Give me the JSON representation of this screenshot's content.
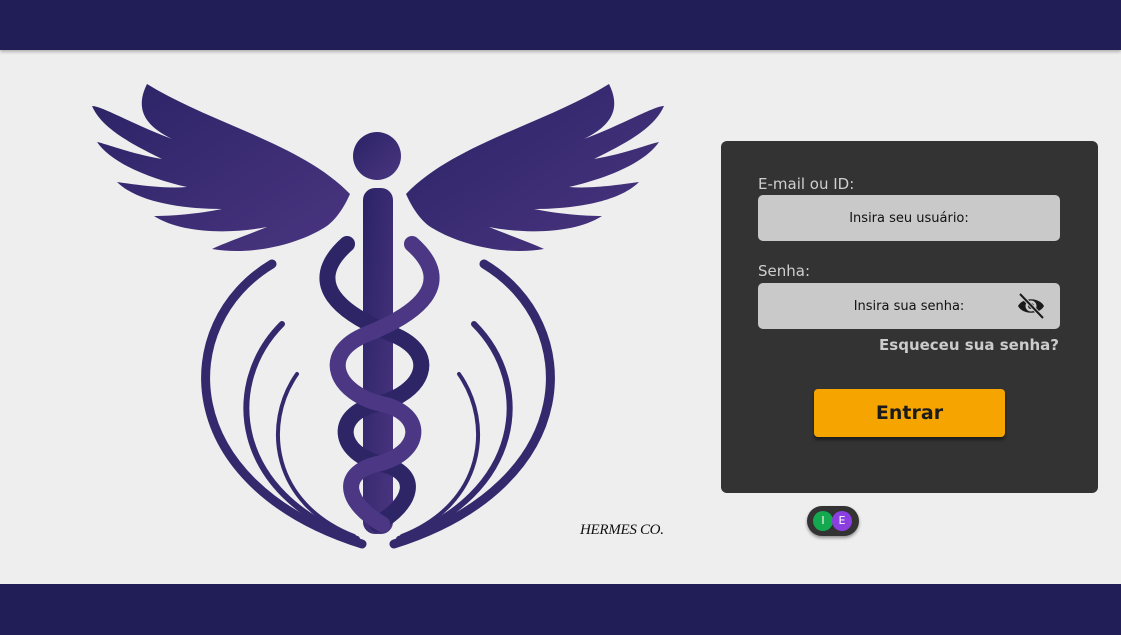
{
  "brand": {
    "name": "HERMES CO."
  },
  "login": {
    "email_label": "E-mail ou ID:",
    "email_placeholder": "Insira seu usuário:",
    "password_label": "Senha:",
    "password_placeholder": "Insira sua senha:",
    "forgot_label": "Esqueceu sua senha?",
    "submit_label": "Entrar"
  },
  "language_toggle": {
    "options": [
      "I",
      "E"
    ]
  },
  "colors": {
    "header": "#211e57",
    "background": "#eeeeee",
    "card": "#333333",
    "input": "#c9c9c9",
    "button": "#f5a400",
    "logo": "#3c2a6e",
    "toggle_i": "#14a84f",
    "toggle_e": "#8b3fe0"
  },
  "icons": {
    "logo": "caduceus-logo",
    "password_visibility": "eye-slash-icon"
  }
}
